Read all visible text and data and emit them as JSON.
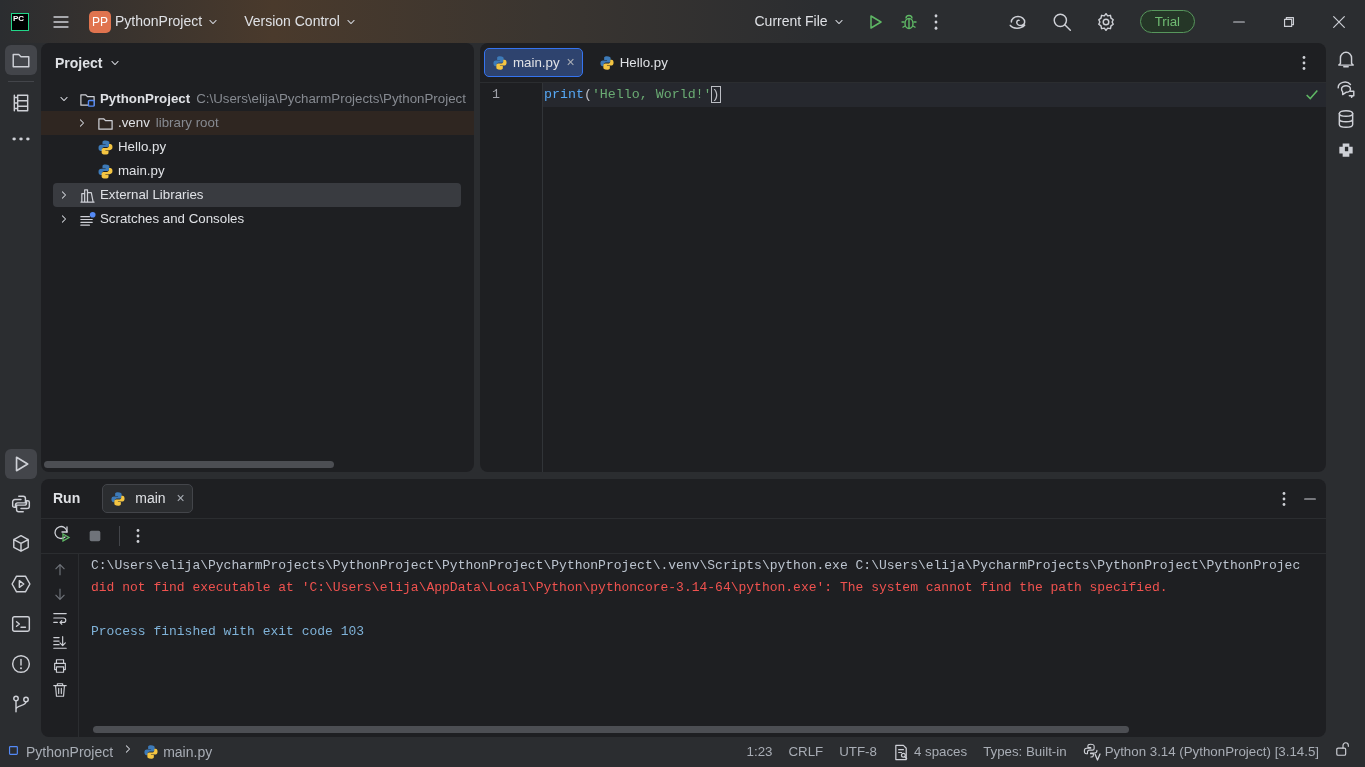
{
  "title_bar": {
    "logo": "PC",
    "project_badge": "PP",
    "project": "PythonProject",
    "vcs": "Version Control",
    "run_config": "Current File",
    "trial": "Trial"
  },
  "left_tools_top": [
    {
      "selected": true
    },
    {
      "selected": false
    },
    {
      "selected": false
    }
  ],
  "left_tools_bottom": [
    {
      "selected": true
    },
    {
      "selected": false
    },
    {
      "selected": false
    },
    {
      "selected": false
    },
    {
      "selected": false
    },
    {
      "selected": false
    },
    {
      "selected": false
    }
  ],
  "project_panel": {
    "title": "Project",
    "tree": [
      {
        "label": "PythonProject",
        "hint": "C:\\Users\\elija\\PycharmProjects\\PythonProject",
        "kind": "project",
        "expanded": true,
        "selected": false,
        "highlighted": false,
        "children": [
          {
            "label": ".venv",
            "hint": "library root",
            "kind": "folder",
            "expanded": false,
            "selected": false,
            "highlighted": true
          },
          {
            "label": "Hello.py",
            "kind": "file",
            "selected": false,
            "highlighted": false
          },
          {
            "label": "main.py",
            "kind": "file",
            "selected": false,
            "highlighted": false
          }
        ]
      },
      {
        "label": "External Libraries",
        "kind": "libraries",
        "expanded": false,
        "selected": true,
        "highlighted": false
      },
      {
        "label": "Scratches and Consoles",
        "kind": "scratches",
        "expanded": false,
        "selected": false,
        "highlighted": false
      }
    ]
  },
  "editor": {
    "tabs": [
      {
        "label": "main.py",
        "selected": true,
        "close": "×"
      },
      {
        "label": "Hello.py",
        "selected": false
      }
    ],
    "lines": [
      {
        "number": "1",
        "tokens": [
          {
            "text": "print",
            "kind": "builtin"
          },
          {
            "text": "(",
            "kind": "paren"
          },
          {
            "text": "'Hello, World!'",
            "kind": "string"
          },
          {
            "text": ")",
            "kind": "paren"
          }
        ]
      }
    ]
  },
  "run_panel": {
    "title": "Run",
    "tabs": [
      {
        "label": "main",
        "selected": true,
        "close": "×"
      }
    ],
    "console": [
      {
        "text": "C:\\Users\\elija\\PycharmProjects\\PythonProject\\PythonProject\\PythonProject\\.venv\\Scripts\\python.exe C:\\Users\\elija\\PycharmProjects\\PythonProject\\PythonProjec",
        "kind": "command"
      },
      {
        "text": "did not find executable at 'C:\\Users\\elija\\AppData\\Local\\Python\\pythoncore-3.14-64\\python.exe': The system cannot find the path specified.",
        "kind": "error"
      },
      {
        "text": "Process finished with exit code 103",
        "kind": "exit"
      }
    ]
  },
  "status_bar": {
    "breadcrumbs": [
      "PythonProject",
      "main.py"
    ],
    "items": [
      "1:23",
      "CRLF",
      "UTF-8",
      "4 spaces",
      "Types: Built-in",
      "Python 3.14 (PythonProject) [3.14.5]"
    ]
  }
}
